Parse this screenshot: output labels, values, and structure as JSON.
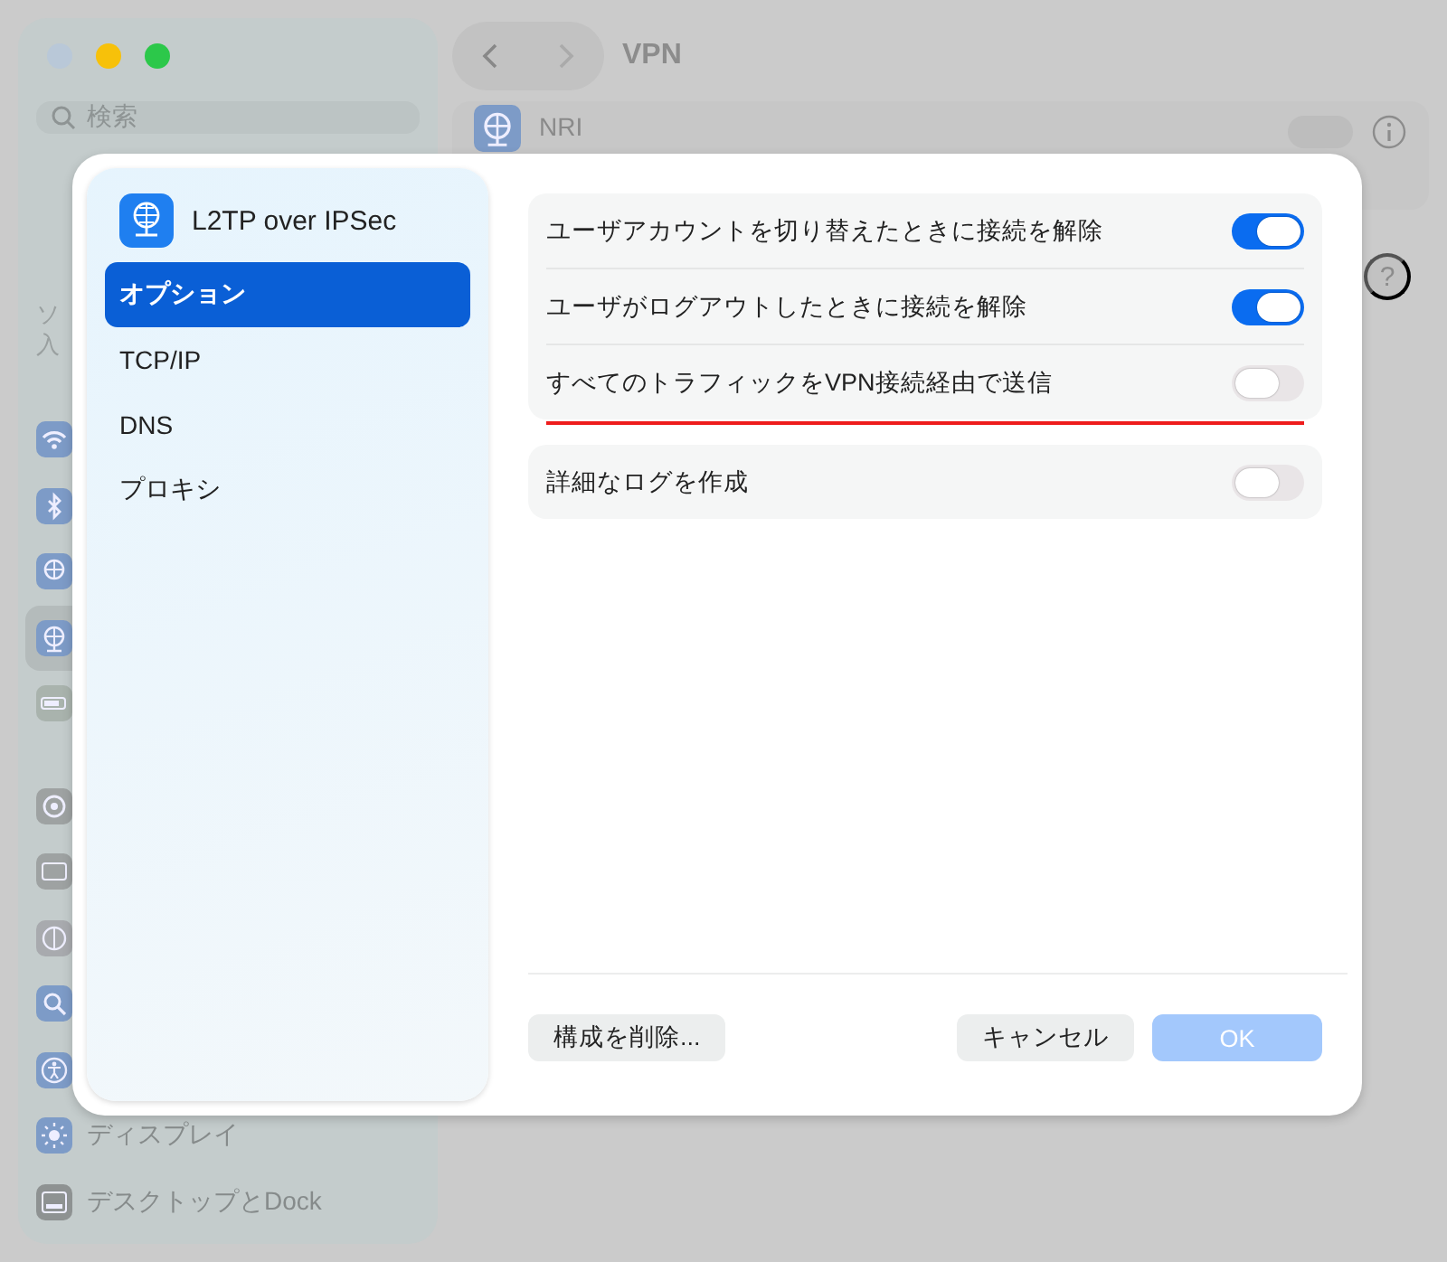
{
  "background_window": {
    "title": "VPN",
    "search": {
      "placeholder": "検索"
    },
    "sidebar": {
      "cut_texts": [
        "ソ",
        "入"
      ],
      "groups": [
        [
          {
            "kind": "wifi",
            "selected": false
          },
          {
            "kind": "bluetooth",
            "selected": false
          },
          {
            "kind": "globe",
            "selected": false
          },
          {
            "kind": "vpn",
            "selected": true
          },
          {
            "kind": "battery",
            "selected": false
          }
        ],
        [
          {
            "kind": "gear",
            "selected": false
          },
          {
            "kind": "panel",
            "selected": false
          },
          {
            "kind": "appearance",
            "selected": false
          },
          {
            "kind": "spotlight",
            "selected": false
          },
          {
            "kind": "accessibility",
            "selected": false
          },
          {
            "kind": "display",
            "label": "ディスプレイ",
            "selected": false
          },
          {
            "kind": "desktop",
            "label": "デスクトップとDock",
            "selected": false
          }
        ]
      ]
    },
    "vpn_row": {
      "name": "NRI",
      "on": false
    },
    "help": "?"
  },
  "dialog": {
    "title": "L2TP over IPSec",
    "tabs": [
      {
        "label": "オプション",
        "selected": true
      },
      {
        "label": "TCP/IP",
        "selected": false
      },
      {
        "label": "DNS",
        "selected": false
      },
      {
        "label": "プロキシ",
        "selected": false
      }
    ],
    "groups": [
      [
        {
          "label": "ユーザアカウントを切り替えたときに接続を解除",
          "on": true,
          "underlined": false
        },
        {
          "label": "ユーザがログアウトしたときに接続を解除",
          "on": true,
          "underlined": false
        },
        {
          "label": "すべてのトラフィックをVPN接続経由で送信",
          "on": false,
          "underlined": true
        }
      ],
      [
        {
          "label": "詳細なログを作成",
          "on": false,
          "underlined": false
        }
      ]
    ],
    "buttons": [
      {
        "label": "構成を削除...",
        "kind": "normal",
        "disabled": false
      },
      {
        "label": "キャンセル",
        "kind": "normal",
        "disabled": false
      },
      {
        "label": "OK",
        "kind": "default",
        "disabled": true
      }
    ]
  }
}
